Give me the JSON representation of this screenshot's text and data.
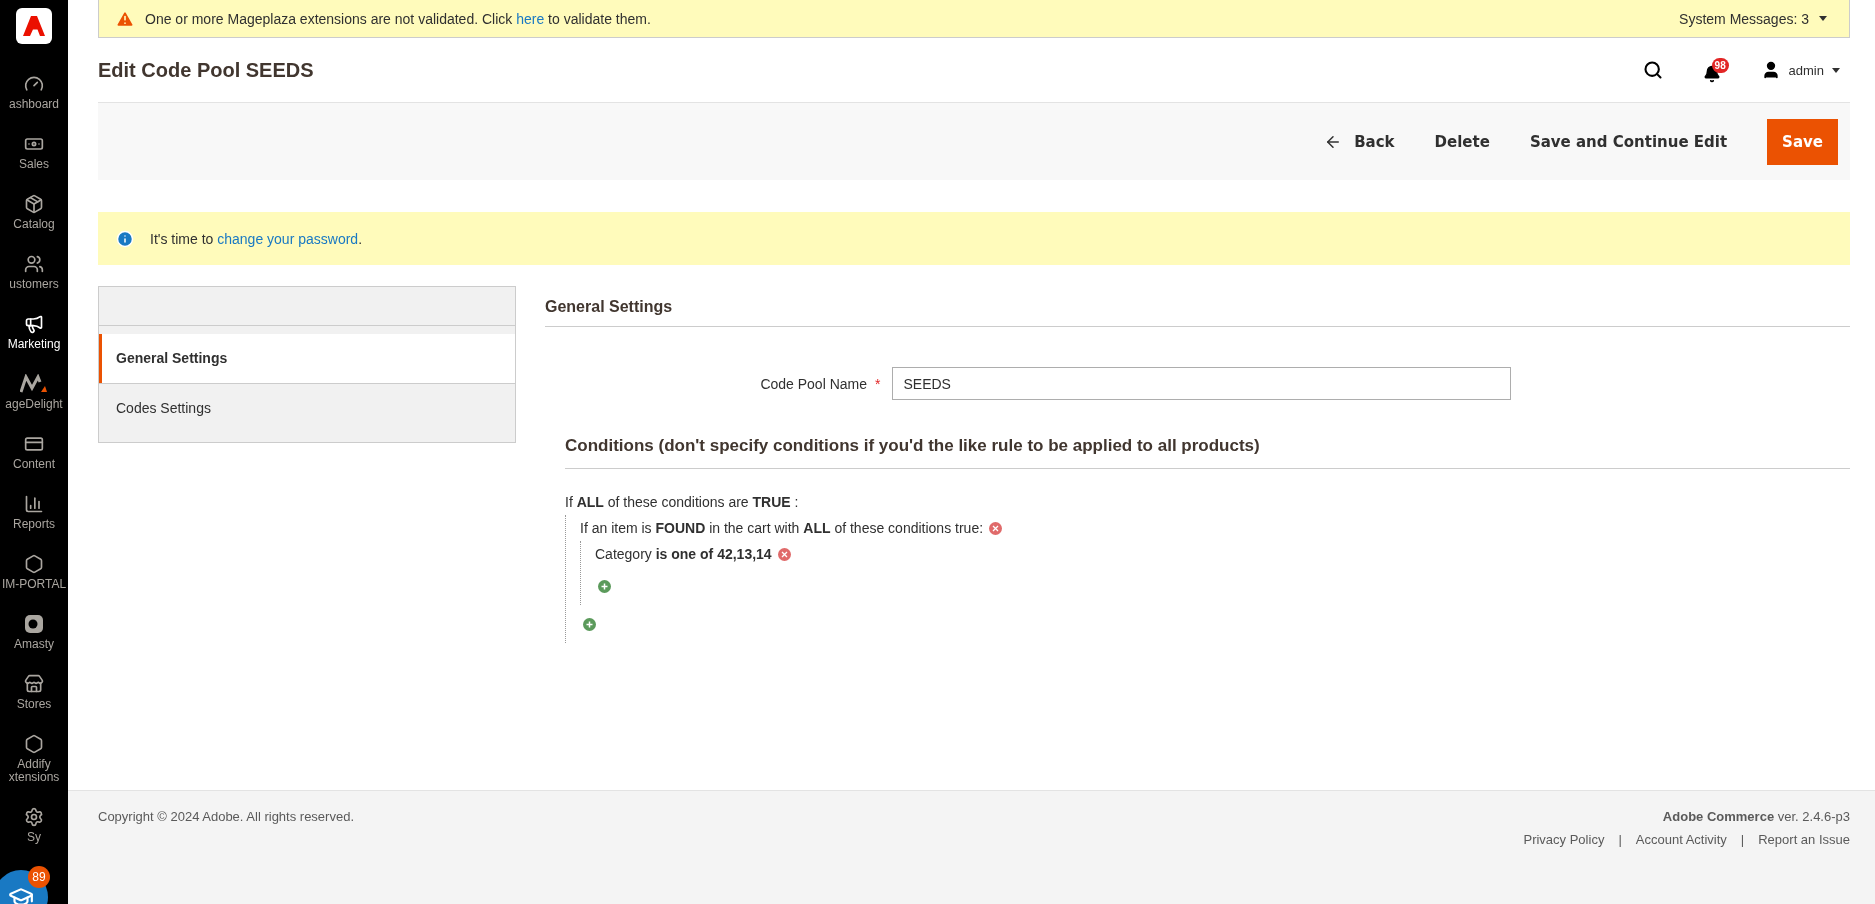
{
  "system_message": {
    "text": "One or more Mageplaza extensions are not validated. Click ",
    "link": "here",
    "text_after": " to validate them.",
    "counter": "System Messages: 3"
  },
  "sidebar": {
    "items": [
      {
        "label": "ashboard",
        "kind": "gauge",
        "selected": false
      },
      {
        "label": "Sales",
        "kind": "money",
        "selected": false
      },
      {
        "label": "Catalog",
        "kind": "box",
        "selected": false
      },
      {
        "label": "ustomers",
        "kind": "people",
        "selected": false
      },
      {
        "label": "Marketing",
        "kind": "megaphone",
        "selected": true
      },
      {
        "label": "ageDelight",
        "kind": "zigzag",
        "selected": false
      },
      {
        "label": "Content",
        "kind": "layout",
        "selected": false
      },
      {
        "label": "Reports",
        "kind": "bars",
        "selected": false
      },
      {
        "label": "IM-PORTAL",
        "kind": "hexagon",
        "selected": false
      },
      {
        "label": "Amasty",
        "kind": "letter",
        "selected": false
      },
      {
        "label": "Stores",
        "kind": "store",
        "selected": false
      },
      {
        "label": "Addify",
        "label2": "xtensions",
        "kind": "hexagon",
        "selected": false
      },
      {
        "label": "Sy",
        "kind": "gear",
        "selected": false
      }
    ]
  },
  "help_badge": "89",
  "header": {
    "title": "Edit Code Pool SEEDS",
    "notifications": "98",
    "user": "admin"
  },
  "actions": [
    {
      "label": "Back",
      "kind": "back"
    },
    {
      "label": "Delete",
      "kind": "plain"
    },
    {
      "label": "Save and Continue Edit",
      "kind": "plain"
    },
    {
      "label": "Save",
      "kind": "primary"
    }
  ],
  "notice": {
    "text": "It's time to ",
    "link": "change your password",
    "text_after": "."
  },
  "tabs": [
    {
      "label": "General Settings",
      "selected": true
    },
    {
      "label": "Codes Settings",
      "selected": false
    }
  ],
  "section_title": "General Settings",
  "field": {
    "label": "Code Pool Name",
    "required": true,
    "required_mark": "*",
    "value": "SEEDS"
  },
  "conditions": {
    "title": "Conditions (don't specify conditions if you'd the like rule to be applied to all products)",
    "root": {
      "text": "If **ALL** of these conditions are **TRUE** :",
      "removable": false,
      "children": [
        {
          "text": "If an item is **FOUND** in the cart with **ALL** of these conditions true:",
          "removable": true,
          "children": [
            {
              "text": "Category **is one of** **42,13,14**",
              "removable": true
            }
          ]
        }
      ]
    }
  },
  "footer": {
    "copyright": "Copyright © 2024 Adobe. All rights reserved.",
    "product": "Adobe Commerce",
    "version": " ver. 2.4.6-p3",
    "links": [
      "Privacy Policy",
      "Account Activity",
      "Report an Issue"
    ],
    "separators": [
      "|",
      "|"
    ]
  }
}
